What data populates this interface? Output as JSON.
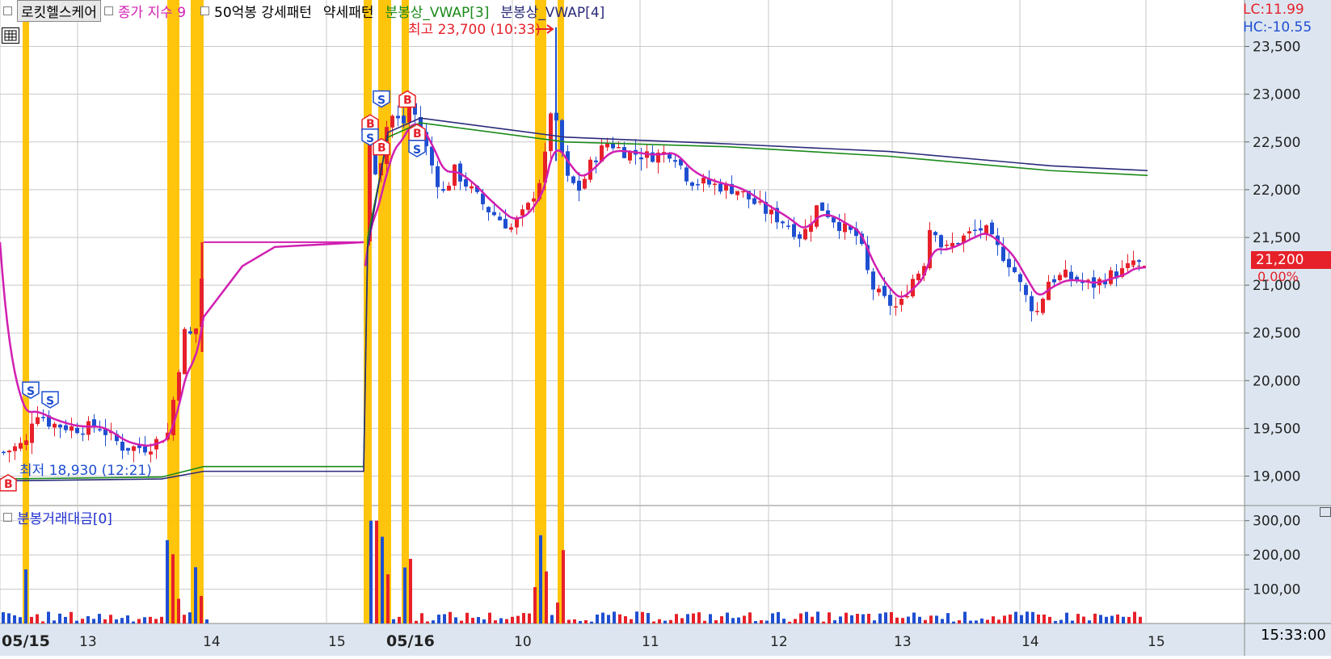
{
  "legend": {
    "items": [
      {
        "label": "로킷헬스케어",
        "color": "#000000",
        "boxed": true
      },
      {
        "label": "종가 지수 9",
        "color": "#d11fb1"
      },
      {
        "label": "50억봉 강세패턴",
        "color": "#000000"
      },
      {
        "label": "약세패턴",
        "color": "#000000"
      },
      {
        "label": "분봉상_VWAP[3]",
        "color": "#1a8a1a"
      },
      {
        "label": "분봉상_VWAP[4]",
        "color": "#2a2a7a"
      }
    ]
  },
  "volume_legend": {
    "label": "분봉거래대금[0]"
  },
  "right_panel": {
    "lc": "LC:11.99",
    "hc": "HC:-10.55",
    "current_price": "21,200",
    "change_pct": "0.00%",
    "time": "15:33:00"
  },
  "annotations": {
    "high": "최고 23,700 (10:33)",
    "low": "최저 18,930 (12:21)"
  },
  "colors": {
    "up": "#e6212a",
    "down": "#1f4fd1",
    "ma": "#d11fb1",
    "vwap3": "#1a8a1a",
    "vwap4": "#2a2a7a",
    "highlight": "#ffc200",
    "grid": "#c8c8c8",
    "axis_bg": "#ffffff"
  },
  "chart_data": {
    "type": "candlestick",
    "title": "로킷헬스케어",
    "price_axis": {
      "ticks": [
        "23,500",
        "23,000",
        "22,500",
        "22,000",
        "21,500",
        "21,000",
        "20,500",
        "20,000",
        "19,500",
        "19,000"
      ],
      "ylim": [
        18700,
        23750
      ]
    },
    "volume_axis": {
      "ticks": [
        "300,00",
        "200,00",
        "100,00"
      ],
      "ylim": [
        0,
        330
      ]
    },
    "x_tick_labels": [
      "05/15",
      "13",
      "14",
      "15",
      "05/16",
      "10",
      "11",
      "12",
      "13",
      "14",
      "15"
    ],
    "sessions": [
      {
        "date": "05/15",
        "x_range": [
          0,
          446
        ],
        "close_level": 21450
      },
      {
        "date": "05/16",
        "x_range": [
          452,
          1420
        ],
        "close_level": 21200
      }
    ],
    "markers": [
      {
        "type": "B",
        "session": "05/15",
        "price": 18930
      },
      {
        "type": "S",
        "session": "05/15",
        "price": 19900
      },
      {
        "type": "S",
        "session": "05/15",
        "price": 19800
      },
      {
        "type": "B",
        "session": "05/16",
        "price": 22600
      },
      {
        "type": "S",
        "session": "05/16",
        "price": 22550
      },
      {
        "type": "B",
        "session": "05/16",
        "price": 22450
      },
      {
        "type": "S",
        "session": "05/16",
        "price": 22950
      },
      {
        "type": "B",
        "session": "05/16",
        "price": 22950
      },
      {
        "type": "B",
        "session": "05/16",
        "price": 22600
      },
      {
        "type": "S",
        "session": "05/16",
        "price": 22430
      }
    ],
    "high": {
      "price": 23700,
      "time": "10:33"
    },
    "low": {
      "price": 18930,
      "time": "12:21"
    },
    "last_price": 21200,
    "vwap3_end": 22150,
    "vwap4_end": 22200
  }
}
